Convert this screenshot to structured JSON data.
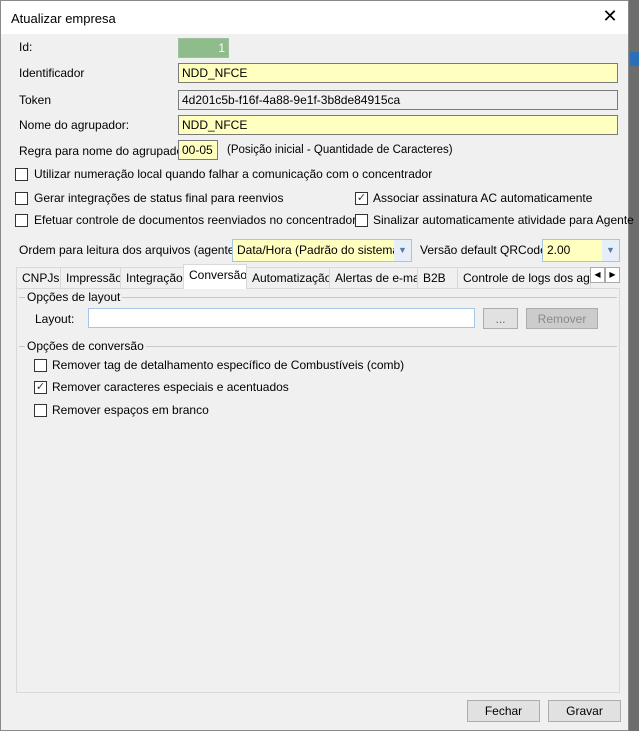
{
  "window": {
    "title": "Atualizar empresa",
    "close_icon": "close-icon"
  },
  "fields": {
    "id": {
      "label": "Id:",
      "value": "1"
    },
    "identificador": {
      "label": "Identificador",
      "value": "NDD_NFCE"
    },
    "token": {
      "label": "Token",
      "value": "4d201c5b-f16f-4a88-9e1f-3b8de84915ca"
    },
    "nome_agrupador": {
      "label": "Nome do agrupador:",
      "value": "NDD_NFCE"
    },
    "regra": {
      "label": "Regra para nome do agrupador:",
      "value": "00-05",
      "hint": "(Posição inicial - Quantidade de Caracteres)"
    }
  },
  "checkboxes": [
    {
      "label": "Utilizar numeração local quando falhar a comunicação com o concentrador",
      "checked": false
    },
    {
      "label": "Gerar integrações de status final para reenvios",
      "checked": false
    },
    {
      "label": "Associar assinatura AC automaticamente",
      "checked": true
    },
    {
      "label": "Efetuar controle de documentos reenviados no concentrador",
      "checked": false
    },
    {
      "label": "Sinalizar automaticamente atividade para Agente",
      "checked": false
    }
  ],
  "ordem": {
    "label": "Ordem para leitura dos arquivos (agente):",
    "value": "Data/Hora (Padrão do sistema)"
  },
  "qrcode": {
    "label": "Versão default QRCode:",
    "value": "2.00"
  },
  "tabs": [
    "CNPJs",
    "Impressão",
    "Integração",
    "Conversão",
    "Automatização",
    "Alertas de e-mail",
    "B2B",
    "Controle de logs dos agen"
  ],
  "active_tab": "Conversão",
  "layout_group": {
    "title": "Opções de layout",
    "layout_label": "Layout:",
    "layout_value": "",
    "browse": "...",
    "remove": "Remover"
  },
  "conversion_group": {
    "title": "Opções de conversão",
    "options": [
      {
        "label": "Remover tag de detalhamento específico de Combustíveis (comb)",
        "checked": false
      },
      {
        "label": "Remover caracteres especiais e acentuados",
        "checked": true
      },
      {
        "label": "Remover espaços em branco",
        "checked": false
      }
    ]
  },
  "buttons": {
    "close": "Fechar",
    "save": "Gravar"
  },
  "colors": {
    "input_required": "#ffffc0",
    "id_bg": "#8fbc8b"
  }
}
